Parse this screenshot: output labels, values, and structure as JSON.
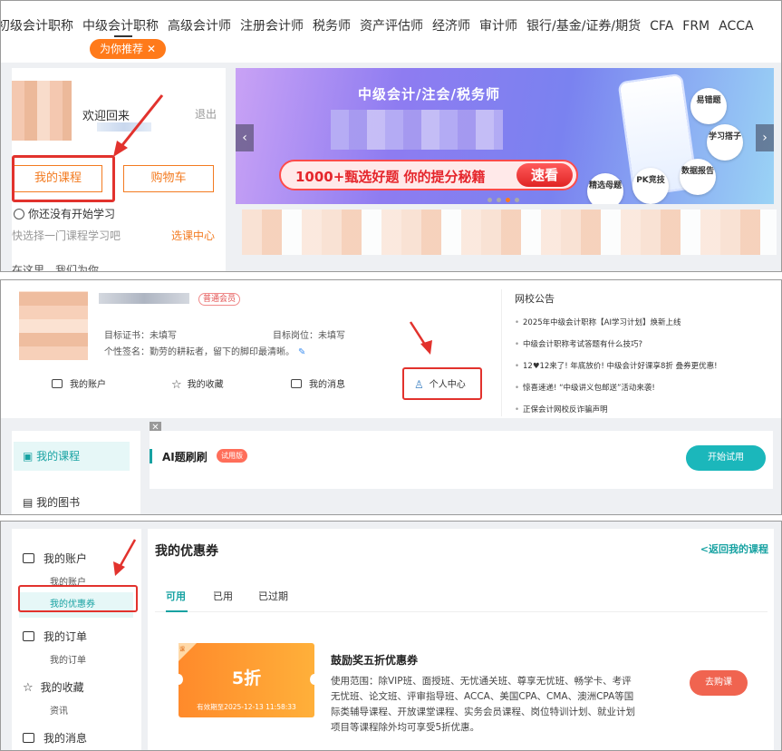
{
  "panel1": {
    "nav": [
      "初级会计职称",
      "中级会计职称",
      "高级会计师",
      "注册会计师",
      "税务师",
      "资产评估师",
      "经济师",
      "审计师",
      "银行/基金/证券/期货",
      "CFA",
      "FRM",
      "ACCA"
    ],
    "recommend_badge": "为你推荐",
    "welcome": "欢迎回来",
    "logout": "退出",
    "my_courses": "我的课程",
    "cart": "购物车",
    "no_study": "你还没有开始学习",
    "pick_course": "快选择一门课程学习吧",
    "pick_link": "选课中心",
    "cut_text": "在这里，我们为你",
    "banner": {
      "title": "中级会计/注会/税务师",
      "slogan": "1000+甄选好题  你的提分秘籍",
      "cta": "速看",
      "bubbles": [
        "易错题",
        "学习搭子",
        "数据报告",
        "PK竞技",
        "精选母题"
      ]
    }
  },
  "panel2": {
    "member_tag": "普通会员",
    "target_cert": "目标证书：未填写",
    "target_post": "目标岗位：未填写",
    "signature": "个性签名：勤劳的耕耘者，留下的脚印最清晰。",
    "quick": [
      "我的账户",
      "我的收藏",
      "我的消息",
      "个人中心"
    ],
    "notice_title": "网校公告",
    "notices": [
      "2025年中级会计职称【AI学习计划】焕新上线",
      "中级会计职称考试答题有什么技巧?",
      "12♥12来了! 年底放价! 中级会计好课享8折 叠券更优惠!",
      "惊喜速递! “中级讲义包邮送”活动来袭!",
      "正保会计网校反诈骗声明"
    ],
    "side_active": "我的课程",
    "side_next": "我的图书",
    "ai_title": "AI题刷刷",
    "ai_tag": "试用版",
    "ai_start": "开始试用"
  },
  "panel3": {
    "side": [
      {
        "label": "我的账户",
        "subs": [
          "我的账户",
          "我的优惠券"
        ]
      },
      {
        "label": "我的订单",
        "subs": [
          "我的订单"
        ]
      },
      {
        "label": "我的收藏",
        "subs": [
          "资讯"
        ]
      },
      {
        "label": "我的消息",
        "subs": []
      }
    ],
    "title": "我的优惠券",
    "back": "<返回我的课程",
    "tabs": [
      "可用",
      "已用",
      "已过期"
    ],
    "coupon": {
      "discount": "5折",
      "stamp": "课",
      "expiry": "有效期至2025-12-13 11:58:33",
      "title": "鼓励奖五折优惠券",
      "desc": "使用范围：除VIP班、面授班、无忧通关班、尊享无忧班、畅学卡、考评无忧班、论文班、评审指导班、ACCA、美国CPA、CMA、澳洲CPA等国际类辅导课程、开放课堂课程、实务会员课程、岗位特训计划、就业计划项目等课程除外均可享受5折优惠。",
      "buy": "去购课"
    }
  },
  "colors": {
    "orange": "#f37b21",
    "teal": "#17a2a2",
    "red_highlight": "#e2322d"
  }
}
